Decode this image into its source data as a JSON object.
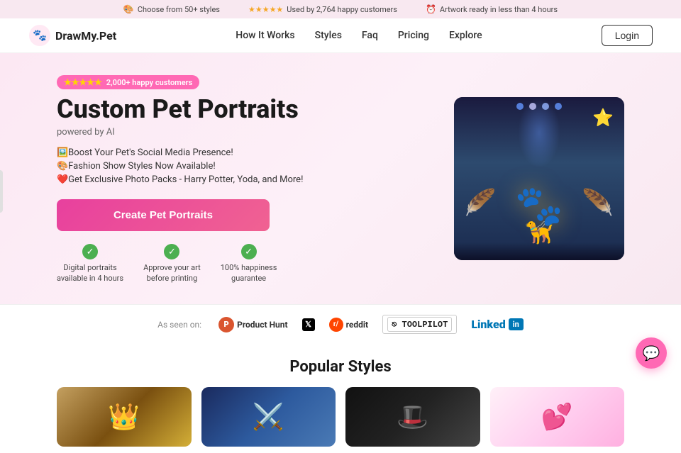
{
  "topBanner": {
    "item1": "Choose from 50+ styles",
    "item1Icon": "🎨",
    "item2": "Used by 2,764 happy customers",
    "item2Stars": "★★★★★",
    "item3": "Artwork ready in less than 4 hours",
    "item3Icon": "⏰"
  },
  "nav": {
    "logo": "DrawMy.Pet",
    "links": [
      "How It Works",
      "Styles",
      "Faq",
      "Pricing",
      "Explore"
    ],
    "loginLabel": "Login"
  },
  "hero": {
    "badgeStars": "★★★★★",
    "badgeText": "2,000+ happy customers",
    "title": "Custom Pet Portraits",
    "subtitle": "powered by AI",
    "feature1": "🖼️Boost Your Pet's Social Media Presence!",
    "feature2": "🎨Fashion Show Styles Now Available!",
    "feature3": "❤️Get Exclusive Photo Packs - Harry Potter, Yoda, and More!",
    "ctaLabel": "Create Pet Portraits",
    "check1Title": "Digital portraits",
    "check1Sub": "available in 4 hours",
    "check2Title": "Approve your art",
    "check2Sub": "before printing",
    "check3Title": "100% happiness",
    "check3Sub": "guarantee"
  },
  "asSeenOn": {
    "label": "As seen on:",
    "brands": [
      "Product Hunt",
      "X",
      "reddit",
      "TOOLPILOT",
      "LinkedIn"
    ]
  },
  "popularStyles": {
    "title": "Popular Styles"
  },
  "chat": {
    "icon": "💬"
  }
}
